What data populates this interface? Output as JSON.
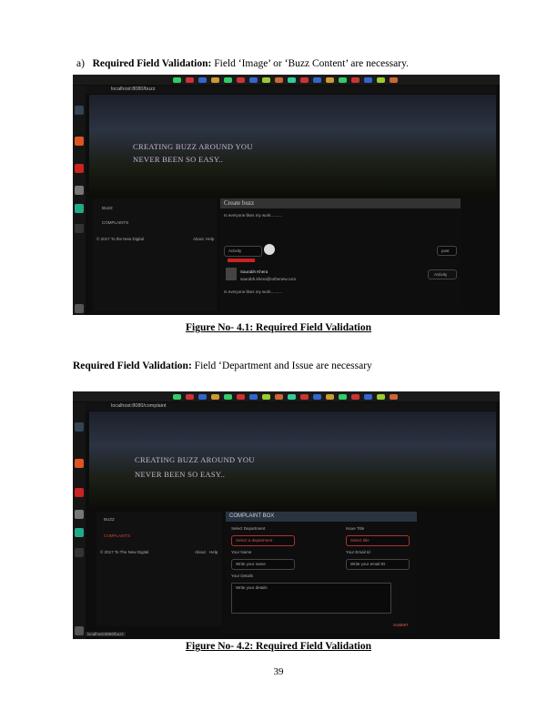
{
  "section_a": {
    "prefix": "a)",
    "bold": "Required Field Validation:",
    "rest": " Field ‘Image’ or ‘Buzz Content’ are necessary."
  },
  "figure1": {
    "caption": "Figure No- 4.1: Required Field Validation",
    "url": "localhost:8080/buzz",
    "hero_line1": "CREATING BUZZ AROUND YOU",
    "hero_line2": "NEVER BEEN SO EASY..",
    "side_buzz": "BUZZ",
    "side_complaints": "COMPLAINTS",
    "side_footer": "© 2017 To the New Digital",
    "side_about": "About",
    "side_help": "Help",
    "create_title": "Create buzz",
    "create_placeholder": "Is everyone likes my work..........",
    "user_name": "Saurabh Khera",
    "user_email": "saurabh.khera@tothenew.com",
    "post_text": "Is everyone likes my work..........",
    "btn_post": "post",
    "btn_activity": "Activity",
    "dropdown_selected": "Activity"
  },
  "section_b": {
    "bold": "Required Field Validation:",
    "rest": " Field ‘Department and Issue are necessary"
  },
  "figure2": {
    "caption": "Figure No- 4.2: Required Field Validation",
    "url": "localhost:8080/complaint",
    "hero_line1": "CREATING BUZZ AROUND YOU",
    "hero_line2": "NEVER BEEN SO EASY..",
    "side_buzz": "BUZZ",
    "side_complaints": "COMPLAINTS",
    "side_footer": "© 2017 To The New Digital",
    "side_about": "About",
    "side_help": "Help",
    "form_title": "COMPLAINT BOX",
    "label_department": "Select Department",
    "label_issue": "Issue Title",
    "department_value": "Select a department",
    "issue_value": "Select title",
    "label_name": "Your Name",
    "label_email": "Your Email Id",
    "name_placeholder": "Write your name",
    "email_placeholder": "Write your email-ID",
    "label_details": "Your Details",
    "details_placeholder": "Write your details",
    "submit": "SUBMIT",
    "status_url": "localhost:8080/buzz"
  },
  "page_number": "39"
}
